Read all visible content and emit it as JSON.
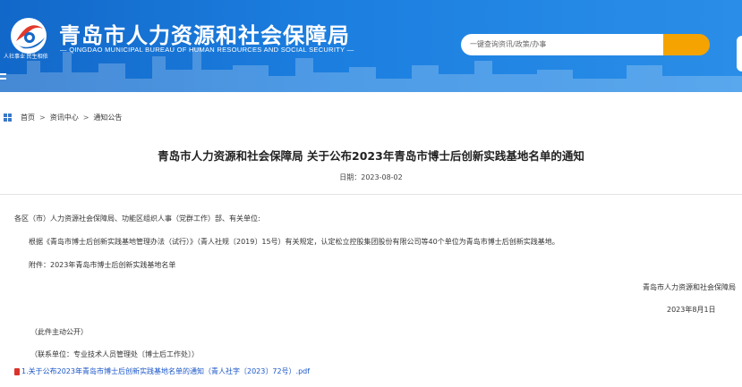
{
  "header": {
    "site_title": "青岛市人力资源和社会保障局",
    "site_subtitle": "QINGDAO MUNICIPAL BUREAU OF HUMAN RESOURCES AND SOCIAL SECURITY",
    "logo_caption": "人社事业  民生相依",
    "search_placeholder": "一键查询资讯/政策/办事",
    "brand_color": "#1c7fe0",
    "search_button_color": "#f5a300"
  },
  "breadcrumb": {
    "icon": "grid-icon",
    "items": [
      "首页",
      "资讯中心",
      "通知公告"
    ],
    "separator": ">"
  },
  "article": {
    "title": "青岛市人力资源和社会保障局 关于公布2023年青岛市博士后创新实践基地名单的通知",
    "date": "日期：2023-08-02",
    "salutation": "各区（市）人力资源社会保障局、功能区组织人事（党群工作）部、有关单位:",
    "body": "根据《青岛市博士后创新实践基地管理办法（试行）》（青人社规〔2019〕15号）有关规定，认定松立控股集团股份有限公司等40个单位为青岛市博士后创新实践基地。",
    "attachment_note": "附件：2023年青岛市博士后创新实践基地名单",
    "signature": "青岛市人力资源和社会保障局",
    "sign_date": "2023年8月1日",
    "disclosure": "（此件主动公开）",
    "contact": "（联系单位：专业技术人员管理处〔博士后工作处〕）",
    "attachment_link": "1.关于公布2023年青岛市博士后创新实践基地名单的通知（青人社字〔2023〕72号）.pdf"
  }
}
